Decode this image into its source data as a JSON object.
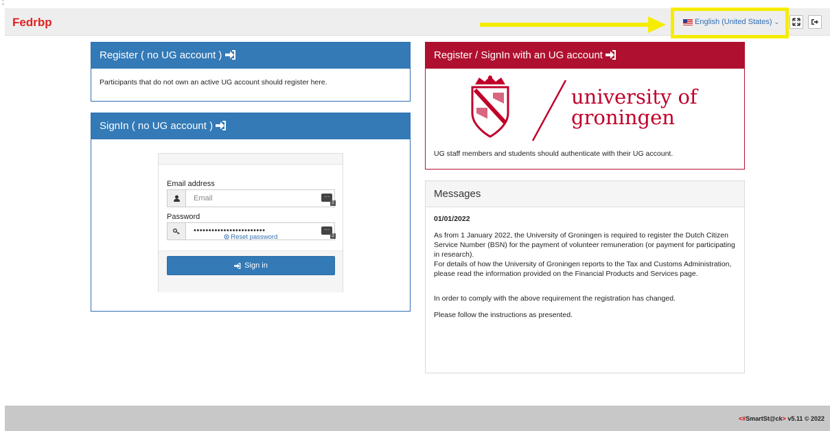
{
  "header": {
    "stray_char": ";",
    "brand": "Fedrbp",
    "language": "English (United States)",
    "caret": "⌄",
    "fullscreen_icon": "expand-icon",
    "logout_icon": "sign-out-icon"
  },
  "register_panel": {
    "title": "Register ( no UG account )",
    "text": "Participants that do not own an active UG account should register here."
  },
  "signin_panel": {
    "title": "SignIn ( no UG account )",
    "email_label": "Email address",
    "email_placeholder": "Email",
    "password_label": "Password",
    "password_value": "••••••••••••••••••••••••",
    "reset_label": "Reset password",
    "signin_label": "Sign in",
    "kbd_badge": "2"
  },
  "ug_panel": {
    "title": "Register / SignIn with an UG account",
    "logo_line1": "university of",
    "logo_line2": "groningen",
    "text": "UG staff members and students should authenticate with their UG account."
  },
  "messages": {
    "title": "Messages",
    "date": "01/01/2022",
    "p1": "As from 1 January 2022, the University of Groningen is required to register the Dutch Citizen Service Number (BSN) for the payment of volunteer remuneration (or payment for participating in research).",
    "p2": "For details of how the University of Groningen reports to the Tax and Customs Administration, please read the information provided on the Financial Products and Services page.",
    "p3": "In order to comply with the above requirement the registration has changed.",
    "p4": "Please follow the instructions as presented."
  },
  "footer": {
    "version_open": "<#",
    "version_brand": "SmartSt@ck",
    "version_close": ">",
    "version_text": " v5.11 © 2022"
  },
  "colors": {
    "brand_red": "#e32020",
    "panel_blue": "#337ab7",
    "ug_red": "#b0102f",
    "highlight": "#f5ed00"
  }
}
